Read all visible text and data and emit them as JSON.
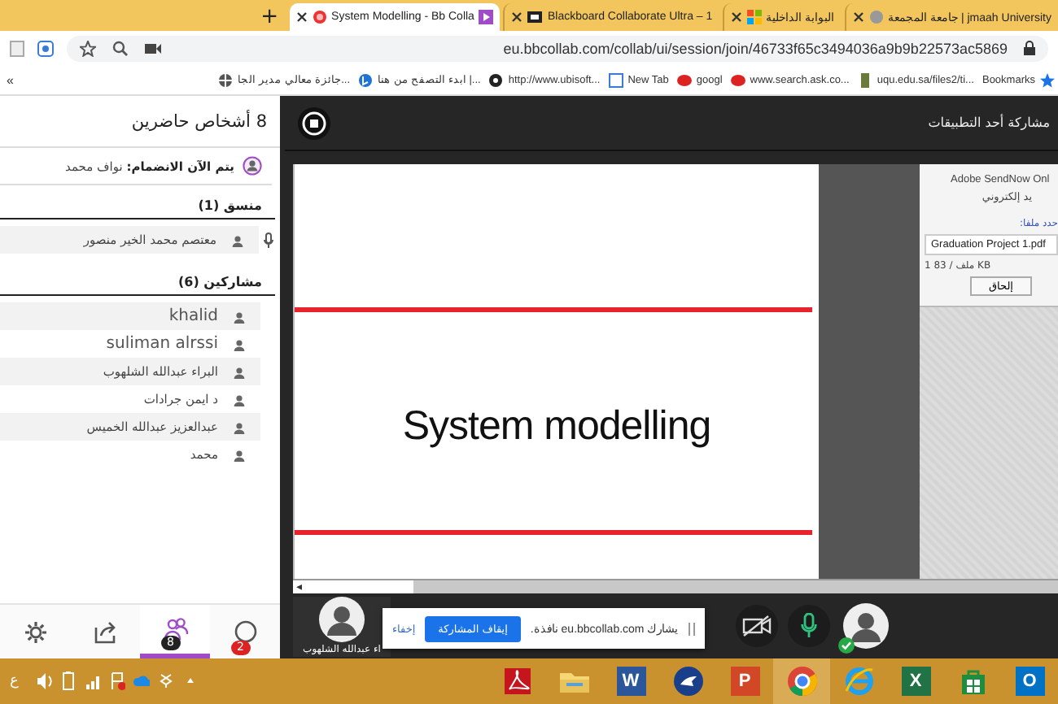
{
  "browser": {
    "new_tab": "+",
    "tabs": [
      {
        "title": "جامعة المجمعة | jmaah University",
        "selected": false,
        "kind": "uni"
      },
      {
        "title": "البوابة الداخلية",
        "selected": false,
        "kind": "windows"
      },
      {
        "title": "Blackboard Collaborate Ultra – 1",
        "selected": false,
        "kind": "bb"
      },
      {
        "title": "System Modelling - Bb Colla",
        "selected": true,
        "kind": "record"
      }
    ],
    "address": "eu.bbcollab.com/collab/ui/session/join/46733f65c3494036a9b9b22573ac5869",
    "bookmarks": [
      {
        "title": "Bookmarks",
        "kind": "star"
      },
      {
        "title": "uqu.edu.sa/files2/ti...",
        "kind": "uni"
      },
      {
        "title": "www.search.ask.co...",
        "kind": "ask"
      },
      {
        "title": "googl",
        "kind": "ask"
      },
      {
        "title": "New Tab",
        "kind": "page"
      },
      {
        "title": "http://www.ubisoft...",
        "kind": "disc"
      },
      {
        "title": "ابدء التصفح من هنا |...",
        "kind": "bing"
      },
      {
        "title": "جائزة معالي مدير الجا...",
        "kind": "globe"
      }
    ],
    "bookmarks_overflow": "«"
  },
  "attendees": {
    "title": "8 أشخاص حاضرين",
    "joining": {
      "label": "يتم الآن الانضمام:",
      "name": "نواف محمد"
    },
    "groups": [
      {
        "title": "منسق (1)",
        "people": [
          {
            "name": "معتصم محمد الخير منصور",
            "mic": true
          }
        ]
      },
      {
        "title": "مشاركين (6)",
        "people": [
          {
            "name": "khalid",
            "mic": false
          },
          {
            "name": "suliman alrssi",
            "mic": false
          },
          {
            "name": "البراء عبدالله الشلهوب",
            "mic": false
          },
          {
            "name": "د ايمن جرادات",
            "mic": false
          },
          {
            "name": "عبدالعزيز عبدالله الخميس",
            "mic": false
          },
          {
            "name": "محمد",
            "mic": false
          }
        ]
      }
    ]
  },
  "panel_tabs": [
    {
      "kind": "chat",
      "badge": "2",
      "selected": false
    },
    {
      "kind": "attendees",
      "badge": "8",
      "selected": true
    },
    {
      "kind": "share",
      "selected": false
    },
    {
      "kind": "settings",
      "selected": false
    }
  ],
  "share": {
    "title": "مشاركة أحد التطبيقات",
    "slide_title": "System modelling",
    "side_panel": {
      "title": "Adobe SendNow Onl",
      "subtitle": "يد إلكتروني",
      "file_label": "حدد ملفا:",
      "file_value": "Graduation Project 1.pdf",
      "file_info": "1 ملف / 83 KB",
      "attach_button": "إلحاق"
    },
    "scroll_arrow": "◂"
  },
  "presenter": {
    "name": "اء عبدالله الشلهوب"
  },
  "share_notice": {
    "message": "يشارك eu.bbcollab.com نافذة.",
    "stop_button": "إيقاف المشاركة",
    "hide_link": "إخفاء"
  },
  "controls": {
    "camera_on": false,
    "mic_on": true
  },
  "taskbar": {
    "language": "ع",
    "apps": [
      {
        "kind": "tile",
        "glyph": "O",
        "color": "#0072c6"
      },
      {
        "kind": "store"
      },
      {
        "kind": "tile",
        "glyph": "X",
        "color": "#217346"
      },
      {
        "kind": "ie"
      },
      {
        "kind": "chrome"
      },
      {
        "kind": "tile",
        "glyph": "P",
        "color": "#d24726"
      },
      {
        "kind": "bird"
      },
      {
        "kind": "tile",
        "glyph": "W",
        "color": "#2b579a"
      },
      {
        "kind": "folder"
      },
      {
        "kind": "acrobat"
      }
    ]
  }
}
